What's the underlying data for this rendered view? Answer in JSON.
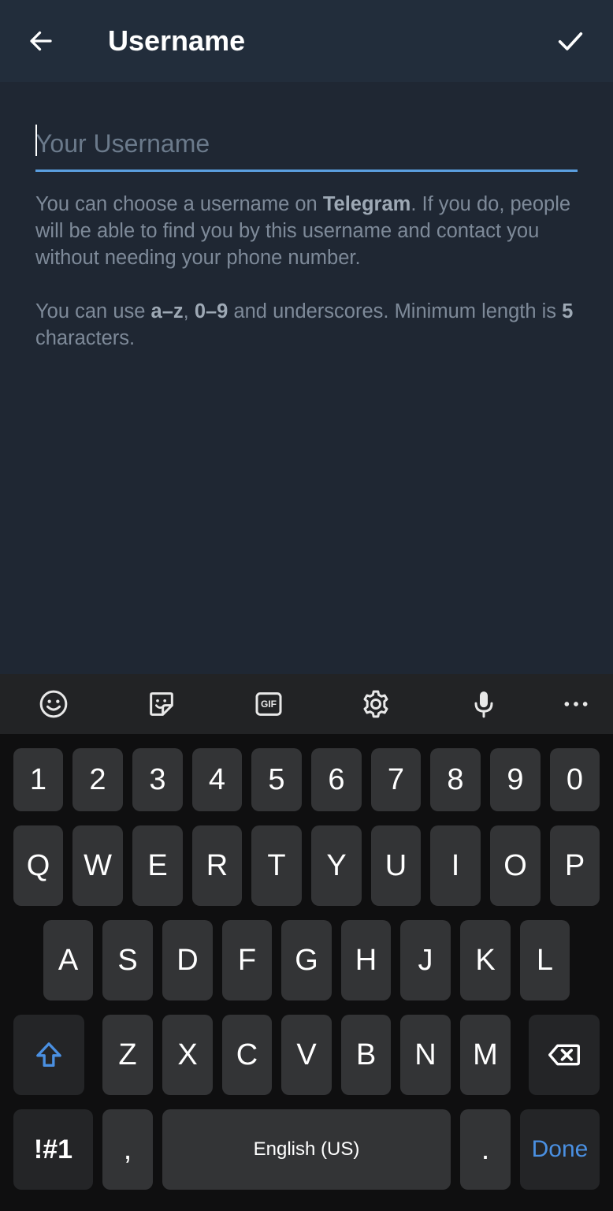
{
  "header": {
    "title": "Username",
    "back_icon": "arrow-left-icon",
    "confirm_icon": "checkmark-icon"
  },
  "username_field": {
    "value": "",
    "placeholder": "Your Username",
    "accent_color": "#5b9fe0"
  },
  "info": {
    "p1_before": "You can choose a username on ",
    "p1_bold": "Telegram",
    "p1_after": ". If you do, people will be able to find you by this username and contact you without needing your phone number.",
    "p2_a": "You can use ",
    "p2_b": "a–z",
    "p2_c": ", ",
    "p2_d": "0–9",
    "p2_e": " and underscores. Minimum length is ",
    "p2_f": "5",
    "p2_g": " characters."
  },
  "keyboard": {
    "toolbar_icons": [
      "emoji-icon",
      "sticker-icon",
      "gif-icon",
      "settings-icon",
      "microphone-icon",
      "more-icon"
    ],
    "gif_label": "GIF",
    "row_numbers": [
      "1",
      "2",
      "3",
      "4",
      "5",
      "6",
      "7",
      "8",
      "9",
      "0"
    ],
    "row_q": [
      "Q",
      "W",
      "E",
      "R",
      "T",
      "Y",
      "U",
      "I",
      "O",
      "P"
    ],
    "row_a": [
      "A",
      "S",
      "D",
      "F",
      "G",
      "H",
      "J",
      "K",
      "L"
    ],
    "row_z": [
      "Z",
      "X",
      "C",
      "V",
      "B",
      "N",
      "M"
    ],
    "symbols_label": "!#1",
    "comma_label": ",",
    "space_label": "English (US)",
    "period_label": ".",
    "done_label": "Done",
    "done_color": "#4a90e2"
  }
}
